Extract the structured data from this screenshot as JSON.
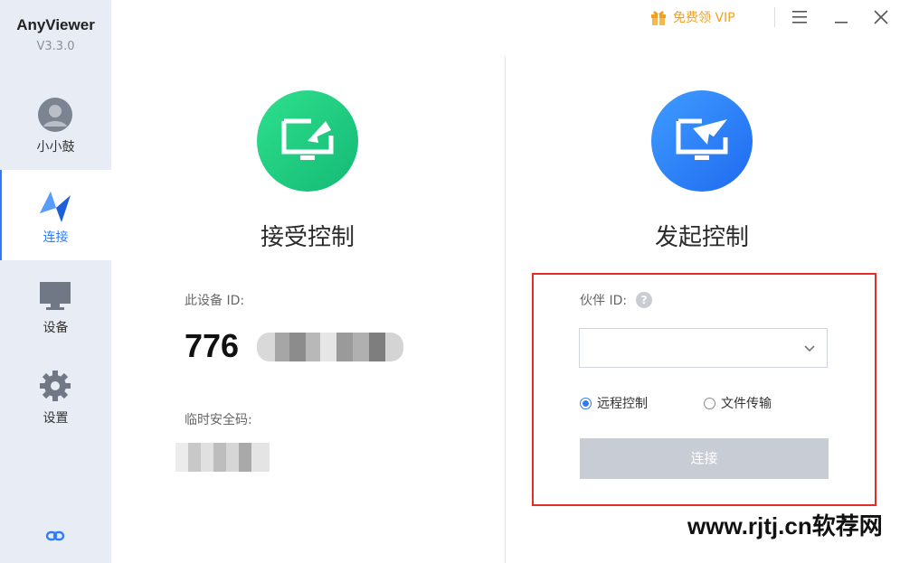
{
  "app": {
    "name": "AnyViewer",
    "version": "V3.3.0"
  },
  "sidebar": {
    "user": {
      "label": "小小鼓"
    },
    "items": [
      {
        "key": "connect",
        "label": "连接",
        "active": true
      },
      {
        "key": "devices",
        "label": "设备",
        "active": false
      },
      {
        "key": "settings",
        "label": "设置",
        "active": false
      }
    ]
  },
  "topbar": {
    "vip_label": "免费领 VIP"
  },
  "receive": {
    "title": "接受控制",
    "device_id_label": "此设备 ID:",
    "device_id_visible": "776",
    "temp_code_label": "临时安全码:"
  },
  "initiate": {
    "title": "发起控制",
    "partner_id_label": "伙伴 ID:",
    "partner_input_value": "",
    "radio_remote": "远程控制",
    "radio_file": "文件传输",
    "selected_mode": "远程控制",
    "connect_button": "连接"
  },
  "watermark": "www.rjtj.cn软荐网",
  "colors": {
    "accent": "#2f7cf6",
    "sidebar_bg": "#e8ecf5",
    "green_circle": "#1fc97f",
    "blue_circle": "#2b80f5",
    "vip": "#f0a020",
    "highlight_frame": "#e52d27",
    "disabled_button": "#c8ccd4"
  }
}
